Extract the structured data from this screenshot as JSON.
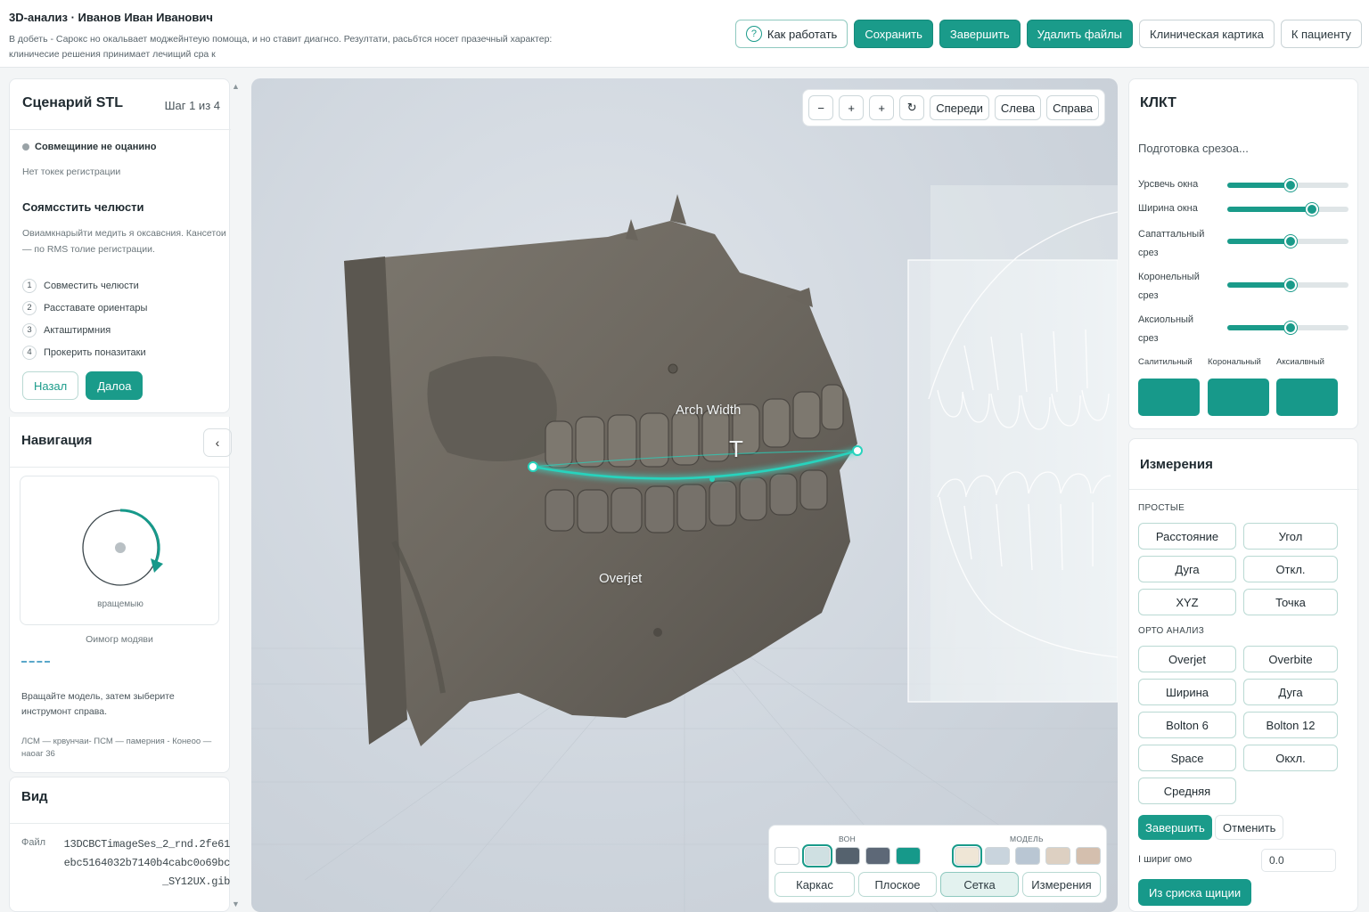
{
  "header": {
    "title": "3D-анализ · Иванов Иван Иванович",
    "disclaimer": "В добеть - Сарокс но окальвает моджейнтеую помоща, и но ставит диагнсо. Резултати, расьбтся носет празечный характер: клиничесие решения принимает лечищий сра к"
  },
  "top_actions": {
    "help": "Как работать",
    "save": "Сохранить",
    "finish": "Завершить",
    "delete": "Удалить файлы",
    "clinical": "Клиническая картика",
    "to_patient": "К пациенту"
  },
  "scenario": {
    "title": "Сценарий STL",
    "step": "Шаг 1 из 4",
    "status": "Совмещиние не оцанино",
    "no_points": "Нет токек регистрации",
    "align_title": "Соямсстить челюсти",
    "align_desc": "Овиамкнарыйти медить я оксавсния. Кансетои — по RMS толие регистрации.",
    "steps": [
      {
        "num": "1",
        "label": "Совместить челюсти"
      },
      {
        "num": "2",
        "label": "Расставате ориентары"
      },
      {
        "num": "3",
        "label": "Акташтирмния"
      },
      {
        "num": "4",
        "label": "Прокерить поназитаки"
      }
    ],
    "back": "Назал",
    "next": "Далоа"
  },
  "navigation": {
    "title": "Навигация",
    "collapse_icon": "chevron-left-icon",
    "rotate_label": "вращемыю",
    "model_view": "Оимогр модяви",
    "hint": "Вращайте модель, затем зыберите инструмонт справа.",
    "legend": "ЛСМ — крвунчаи- ПСМ — памерния - Конеоо — наоаг 36"
  },
  "view": {
    "title": "Вид",
    "file_label": "Файл",
    "file_name": "13DCBCTimageSes_2_rnd.2fe61ebc5164032b7140b4cabc0o69bc_SY12UX.gib"
  },
  "viewport": {
    "toolbar": {
      "zoom_out": "−",
      "zoom_in": "+",
      "add": "+",
      "reset": "↻",
      "front": "Спереди",
      "left": "Слева",
      "right": "Справа"
    },
    "labels": {
      "arch_width": "Arch Width",
      "overjet": "Overjet",
      "marker": "T"
    },
    "bottom_panel": {
      "bg_label": "ВОН",
      "model_label": "МОДЕЛЬ",
      "bg_colors": [
        "#ffffff",
        "#cfe0e2",
        "#55626e",
        "#5d6877",
        "#16998a"
      ],
      "model_colors": [
        "#efe6d6",
        "#c9d4dd",
        "#b9c6d3",
        "#ddd0c2",
        "#d4bfae"
      ],
      "modes": [
        "Каркас",
        "Плоское",
        "Сетка",
        "Измерения"
      ]
    }
  },
  "cbct": {
    "title": "КЛКТ",
    "preparing": "Подготовка срезоа...",
    "sliders": [
      {
        "label": "Урсвечь окна",
        "value": 0.52
      },
      {
        "label": "Ширина окна",
        "value": 0.7
      },
      {
        "label": "Сапаттальный срез",
        "value": 0.52
      },
      {
        "label": "Коронельный срез",
        "value": 0.52
      },
      {
        "label": "Аксиольный срез",
        "value": 0.52
      }
    ],
    "slice_labels": [
      "Салитильный",
      "Корональный",
      "Аксиалвный"
    ]
  },
  "measurements": {
    "title": "Измерения",
    "simple_label": "ПРОСТЫЕ",
    "simple": [
      "Расстояние",
      "Угол",
      "Дуга",
      "Откл.",
      "XYZ",
      "Точка"
    ],
    "ortho_label": "ОРТО АНАЛИЗ",
    "ortho": [
      "Overjet",
      "Overbite",
      "Ширина",
      "Дуга",
      "Bolton 6",
      "Bolton 12",
      "Space",
      "Окхл.",
      "Средняя"
    ],
    "finish": "Завершить",
    "cancel": "Отменить",
    "width_label": "I шириг омо",
    "width_value": "0.0",
    "from_list": "Из сриска щиции"
  },
  "colors": {
    "accent": "#1a9b8a",
    "bone": "#6f6a62"
  }
}
